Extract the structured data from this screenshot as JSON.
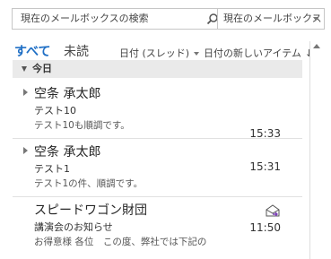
{
  "search": {
    "placeholder": "現在のメールボックスの検索",
    "scope": "現在のメールボックス"
  },
  "filters": {
    "all": "すべて",
    "unread": "未読",
    "sort_by": "日付 (スレッド)",
    "sort_order": "日付の新しいアイテム"
  },
  "group": {
    "label": "今日"
  },
  "messages": [
    {
      "sender": "空条 承太郎",
      "subject": "テスト10",
      "preview": "テスト10も順調です。",
      "time": "15:33"
    },
    {
      "sender": "空条 承太郎",
      "subject": "テスト1",
      "preview": "テスト1の件、順調です。",
      "time": "15:31"
    },
    {
      "sender": "スピードワゴン財団",
      "subject": "講演会のお知らせ",
      "preview": "お得意様 各位　この度、弊社では下記の",
      "time": "11:50"
    }
  ],
  "colors": {
    "accent": "#1f6fc5",
    "meeting_icon": "#7a3fb5"
  }
}
